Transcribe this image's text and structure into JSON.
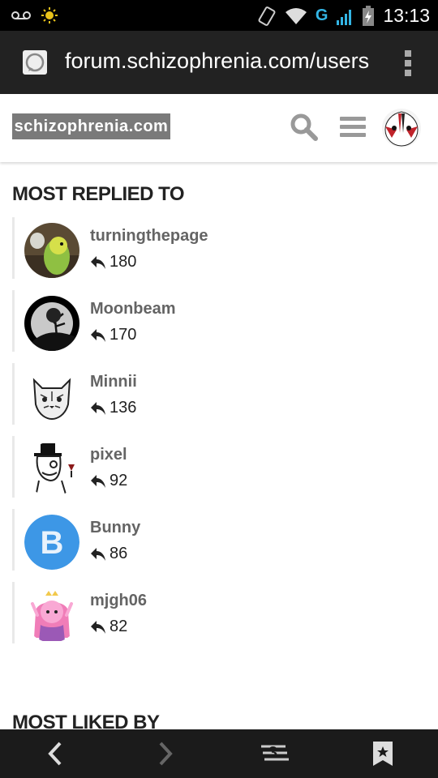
{
  "status_bar": {
    "time": "13:13",
    "network_label": "G"
  },
  "browser": {
    "url": "forum.schizophrenia.com/users"
  },
  "site": {
    "logo_text": "schizophrenia.com"
  },
  "sections": {
    "most_replied_title": "MOST REPLIED TO",
    "most_liked_title": "MOST LIKED BY"
  },
  "users": [
    {
      "name": "turningthepage",
      "count": "180",
      "avatar": "parrot-photo"
    },
    {
      "name": "Moonbeam",
      "count": "170",
      "avatar": "moon-tree"
    },
    {
      "name": "Minnii",
      "count": "136",
      "avatar": "cat-sketch"
    },
    {
      "name": "pixel",
      "count": "92",
      "avatar": "gentleman-meme"
    },
    {
      "name": "Bunny",
      "count": "86",
      "avatar": "letter-avatar",
      "letter": "B",
      "color": "#3d97e6"
    },
    {
      "name": "mjgh06",
      "count": "82",
      "avatar": "pink-princess"
    }
  ],
  "bottom_nav": {
    "tabs_count": "3"
  }
}
